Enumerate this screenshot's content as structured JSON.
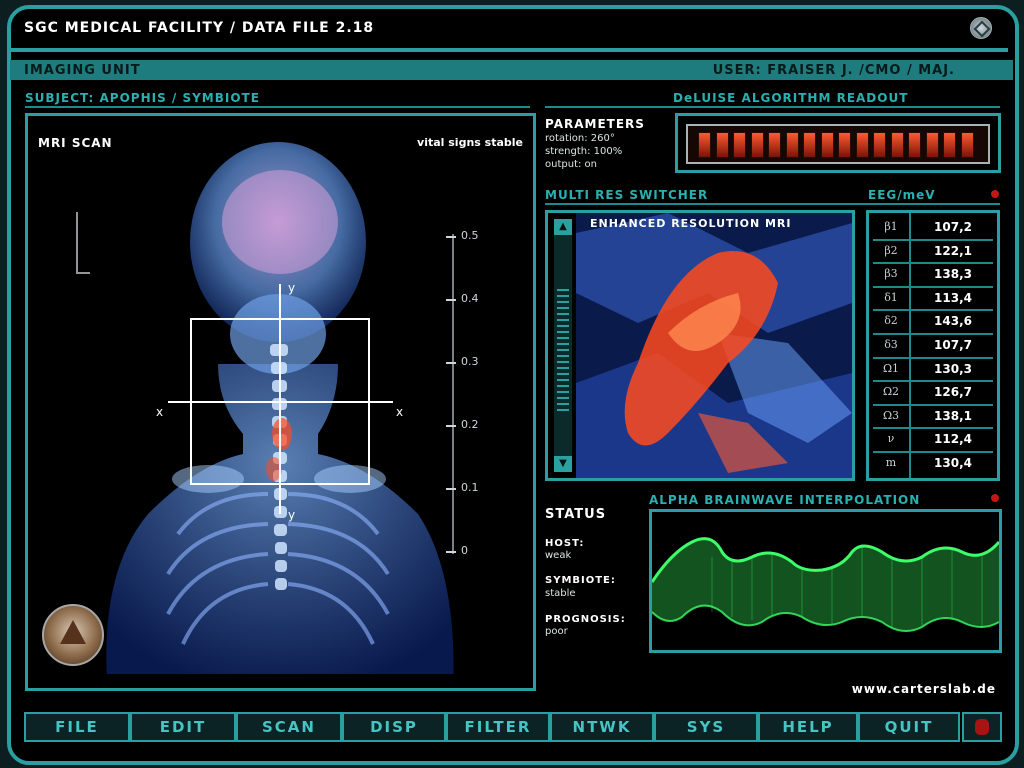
{
  "window": {
    "title": "SGC MEDICAL FACILITY / DATA FILE 2.18"
  },
  "header": {
    "unit": "IMAGING UNIT",
    "user": "USER: FRAISER J. /CMO / MAJ."
  },
  "subject": "SUBJECT: APOPHIS / SYMBIOTE",
  "deluise": {
    "title": "DeLUISE ALGORITHM READOUT",
    "cells": 16
  },
  "mri": {
    "label": "MRI SCAN",
    "vitals": "vital signs stable",
    "scale": [
      "0.5",
      "0.4",
      "0.3",
      "0.2",
      "0.1",
      "0"
    ]
  },
  "parameters": {
    "title": "PARAMETERS",
    "lines": [
      "rotation: 260°",
      "strength: 100%",
      "output: on"
    ]
  },
  "multires": {
    "title": "MULTI RES SWITCHER",
    "image_title": "ENHANCED RESOLUTION MRI"
  },
  "eeg": {
    "title": "EEG/meV",
    "rows": [
      {
        "symbol": "β1",
        "value": "107,2"
      },
      {
        "symbol": "β2",
        "value": "122,1"
      },
      {
        "symbol": "β3",
        "value": "138,3"
      },
      {
        "symbol": "δ1",
        "value": "113,4"
      },
      {
        "symbol": "δ2",
        "value": "143,6"
      },
      {
        "symbol": "δ3",
        "value": "107,7"
      },
      {
        "symbol": "Ω1",
        "value": "130,3"
      },
      {
        "symbol": "Ω2",
        "value": "126,7"
      },
      {
        "symbol": "Ω3",
        "value": "138,1"
      },
      {
        "symbol": "ν",
        "value": "112,4"
      },
      {
        "symbol": "m",
        "value": "130,4"
      }
    ]
  },
  "alpha": {
    "title": "ALPHA BRAINWAVE INTERPOLATION"
  },
  "status": {
    "title": "STATUS",
    "items": [
      {
        "key": "HOST:",
        "value": "weak"
      },
      {
        "key": "SYMBIOTE:",
        "value": "stable"
      },
      {
        "key": "PROGNOSIS:",
        "value": "poor"
      }
    ]
  },
  "website": "www.carterslab.de",
  "menu": [
    "FILE",
    "EDIT",
    "SCAN",
    "DISP",
    "FILTER",
    "NTWK",
    "SYS",
    "HELP",
    "QUIT"
  ],
  "colors": {
    "accent": "#2a9ea0",
    "alert": "#c41616",
    "wave": "#3cff6a",
    "mri_hot": "#ff4a1c"
  }
}
